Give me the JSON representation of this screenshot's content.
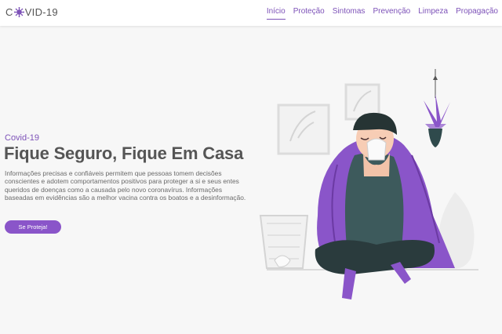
{
  "brand": {
    "logo_left": "C",
    "logo_right": "VID-19"
  },
  "nav": {
    "items": [
      {
        "label": "Início",
        "active": true
      },
      {
        "label": "Proteção",
        "active": false
      },
      {
        "label": "Sintomas",
        "active": false
      },
      {
        "label": "Prevenção",
        "active": false
      },
      {
        "label": "Limpeza",
        "active": false
      },
      {
        "label": "Propagação",
        "active": false
      }
    ]
  },
  "hero": {
    "kicker": "Covid-19",
    "title": "Fique Seguro, Fique Em Casa",
    "text": "Informações precisas e confiáveis permitem que pessoas tomem decisões conscientes e adotem comportamentos positivos para proteger a si e seus entes queridos de doenças como a causada pelo novo coronavírus. Informações baseadas em evidências são a melhor vacina contra os boatos e a desinformação.",
    "button_label": "Se Proteja!"
  },
  "colors": {
    "accent": "#7d52b8",
    "button": "#8a55c9",
    "background": "#f7f7f7"
  },
  "icons": {
    "logo_o": "virus-icon"
  }
}
